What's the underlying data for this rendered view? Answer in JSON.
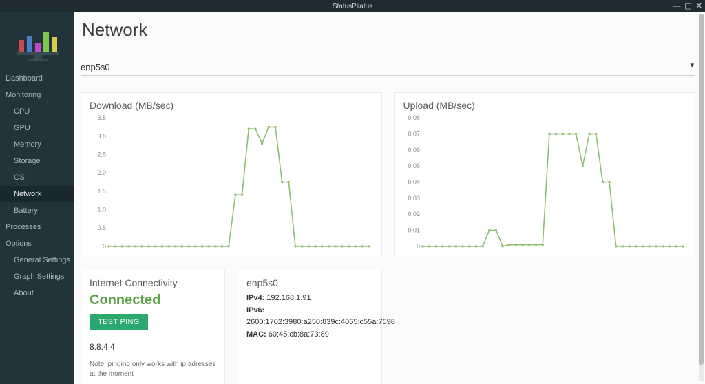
{
  "window": {
    "title": "StatusPilatus"
  },
  "sidebar": {
    "items": [
      {
        "label": "Dashboard",
        "sub": false,
        "active": false
      },
      {
        "label": "Monitoring",
        "sub": false,
        "active": false
      },
      {
        "label": "CPU",
        "sub": true,
        "active": false
      },
      {
        "label": "GPU",
        "sub": true,
        "active": false
      },
      {
        "label": "Memory",
        "sub": true,
        "active": false
      },
      {
        "label": "Storage",
        "sub": true,
        "active": false
      },
      {
        "label": "OS",
        "sub": true,
        "active": false
      },
      {
        "label": "Network",
        "sub": true,
        "active": true
      },
      {
        "label": "Battery",
        "sub": true,
        "active": false
      },
      {
        "label": "Processes",
        "sub": false,
        "active": false
      },
      {
        "label": "Options",
        "sub": false,
        "active": false
      },
      {
        "label": "General Settings",
        "sub": true,
        "active": false
      },
      {
        "label": "Graph Settings",
        "sub": true,
        "active": false
      },
      {
        "label": "About",
        "sub": true,
        "active": false
      }
    ]
  },
  "page": {
    "title": "Network",
    "interface_selected": "enp5s0"
  },
  "connectivity": {
    "title": "Internet Connectivity",
    "status": "Connected",
    "test_button": "TEST PING",
    "ping_target": "8.8.4.4",
    "note": "Note: pinging only works with ip adresses at the moment"
  },
  "iface_details": {
    "title": "enp5s0",
    "ipv4_label": "IPv4:",
    "ipv4": "192.168.1.91",
    "ipv6_label": "IPv6:",
    "ipv6": "2600:1702:3980:a250:839c:4065:c55a:7598",
    "mac_label": "MAC:",
    "mac": "60:45:cb:8a:73:89"
  },
  "colors": {
    "accent": "#8fbf73",
    "titlebar": "#1e2b33",
    "sidebar": "#22333c",
    "connected": "#5aa146",
    "button": "#2aa96f"
  },
  "chart_data": [
    {
      "type": "line",
      "title": "Download (MB/sec)",
      "xlabel": "",
      "ylabel": "",
      "ylim": [
        0,
        3.5
      ],
      "yticks": [
        0,
        0.5,
        1.0,
        1.5,
        2.0,
        2.5,
        3.0,
        3.5
      ],
      "x": [
        0,
        1,
        2,
        3,
        4,
        5,
        6,
        7,
        8,
        9,
        10,
        11,
        12,
        13,
        14,
        15,
        16,
        17,
        18,
        19,
        20,
        21,
        22,
        23,
        24,
        25,
        26,
        27,
        28,
        29,
        30,
        31,
        32,
        33,
        34,
        35,
        36,
        37,
        38,
        39
      ],
      "values": [
        0,
        0,
        0,
        0,
        0,
        0,
        0,
        0,
        0,
        0,
        0,
        0,
        0,
        0,
        0,
        0,
        0,
        0,
        0,
        1.4,
        1.4,
        3.2,
        3.2,
        2.8,
        3.25,
        3.25,
        1.75,
        1.75,
        0,
        0,
        0,
        0,
        0,
        0,
        0,
        0,
        0,
        0,
        0,
        0
      ]
    },
    {
      "type": "line",
      "title": "Upload (MB/sec)",
      "xlabel": "",
      "ylabel": "",
      "ylim": [
        0,
        0.08
      ],
      "yticks": [
        0,
        0.01,
        0.02,
        0.03,
        0.04,
        0.05,
        0.06,
        0.07,
        0.08
      ],
      "x": [
        0,
        1,
        2,
        3,
        4,
        5,
        6,
        7,
        8,
        9,
        10,
        11,
        12,
        13,
        14,
        15,
        16,
        17,
        18,
        19,
        20,
        21,
        22,
        23,
        24,
        25,
        26,
        27,
        28,
        29,
        30,
        31,
        32,
        33,
        34,
        35,
        36,
        37,
        38,
        39
      ],
      "values": [
        0,
        0,
        0,
        0,
        0,
        0,
        0,
        0,
        0,
        0,
        0.01,
        0.01,
        0,
        0.001,
        0.001,
        0.001,
        0.001,
        0.001,
        0.001,
        0.07,
        0.07,
        0.07,
        0.07,
        0.07,
        0.05,
        0.07,
        0.07,
        0.04,
        0.04,
        0,
        0,
        0,
        0,
        0,
        0,
        0,
        0,
        0,
        0,
        0
      ]
    }
  ]
}
